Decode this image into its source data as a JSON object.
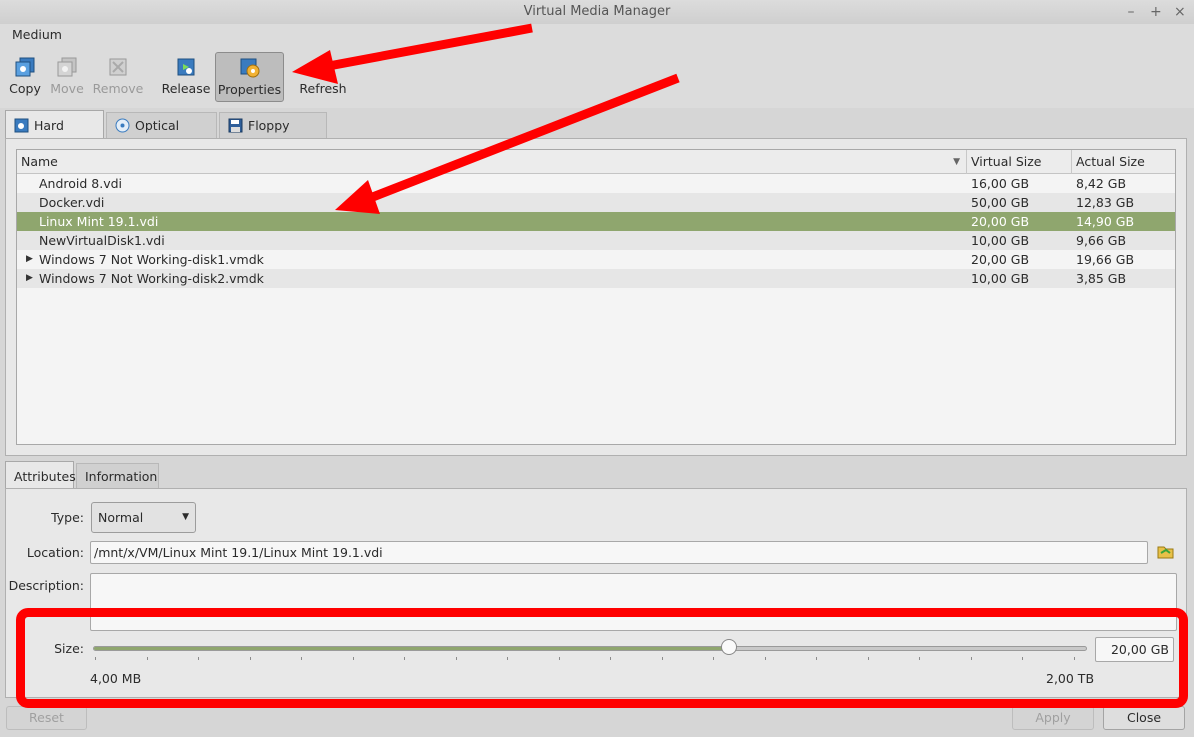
{
  "window": {
    "title": "Virtual Media Manager"
  },
  "menu": {
    "medium": "Medium"
  },
  "toolbar": {
    "copy": "Copy",
    "move": "Move",
    "remove": "Remove",
    "release": "Release",
    "properties": "Properties",
    "refresh": "Refresh"
  },
  "media_tabs": {
    "hard_disks": "Hard disks",
    "optical_disks": "Optical disks",
    "floppy_disks": "Floppy disks"
  },
  "table": {
    "columns": [
      "Name",
      "Virtual Size",
      "Actual Size"
    ],
    "rows": [
      {
        "name": "Android 8.vdi",
        "virtual": "16,00 GB",
        "actual": "8,42 GB"
      },
      {
        "name": "Docker.vdi",
        "virtual": "50,00 GB",
        "actual": "12,83 GB"
      },
      {
        "name": "Linux Mint 19.1.vdi",
        "virtual": "20,00 GB",
        "actual": "14,90 GB"
      },
      {
        "name": "NewVirtualDisk1.vdi",
        "virtual": "10,00 GB",
        "actual": "9,66 GB"
      },
      {
        "name": "Windows 7 Not Working-disk1.vmdk",
        "virtual": "20,00 GB",
        "actual": "19,66 GB"
      },
      {
        "name": "Windows 7 Not Working-disk2.vmdk",
        "virtual": "10,00 GB",
        "actual": "3,85 GB"
      }
    ],
    "selected_index": 2
  },
  "detail_tabs": {
    "attributes": "Attributes",
    "information": "Information"
  },
  "attributes": {
    "type_label": "Type:",
    "type_value": "Normal",
    "location_label": "Location:",
    "location_value": "/mnt/x/VM/Linux Mint 19.1/Linux Mint 19.1.vdi",
    "description_label": "Description:",
    "description_value": "",
    "size_label": "Size:",
    "size_value": "20,00 GB",
    "size_min": "4,00 MB",
    "size_max": "2,00 TB",
    "slider_fraction": 0.64
  },
  "buttons": {
    "reset": "Reset",
    "apply": "Apply",
    "close": "Close"
  },
  "colors": {
    "selection": "#8fa66e",
    "annotation": "#ff0000"
  }
}
